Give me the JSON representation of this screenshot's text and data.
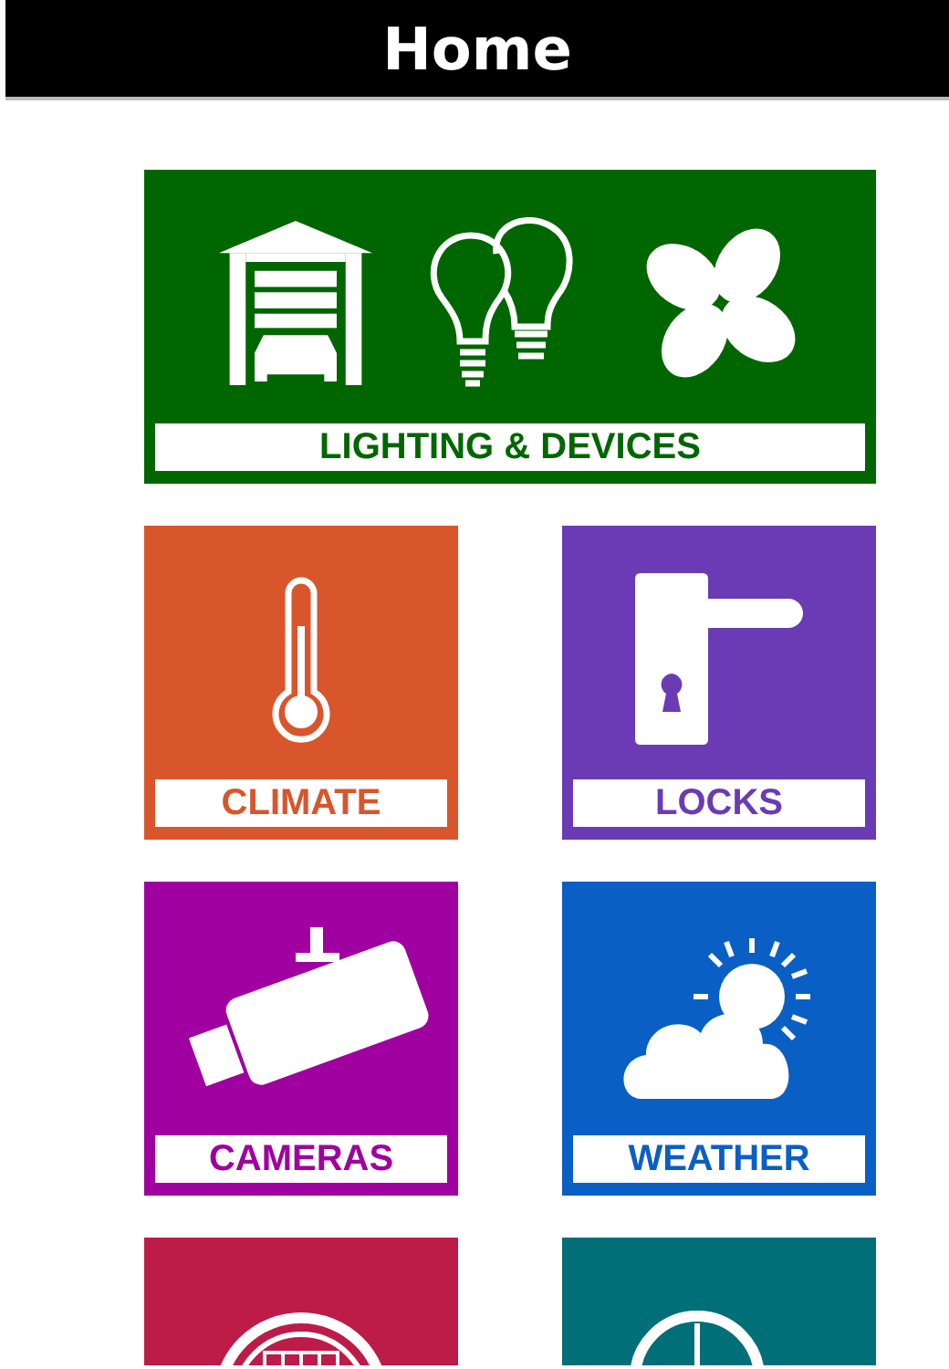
{
  "title": "Home",
  "tiles": [
    {
      "label": "LIGHTING & DEVICES",
      "color": "#006600",
      "wide": true,
      "icons": [
        {
          "kind": "garage"
        },
        {
          "kind": "bulbs"
        },
        {
          "kind": "fan"
        }
      ]
    },
    {
      "label": "CLIMATE",
      "color": "#d9552b",
      "wide": false,
      "icons": [
        {
          "kind": "thermometer"
        }
      ]
    },
    {
      "label": "LOCKS",
      "color": "#6a3bb5",
      "wide": false,
      "icons": [
        {
          "kind": "handle"
        }
      ]
    },
    {
      "label": "CAMERAS",
      "color": "#a000a0",
      "wide": false,
      "icons": [
        {
          "kind": "camera"
        }
      ]
    },
    {
      "label": "WEATHER",
      "color": "#0a5fc4",
      "wide": false,
      "icons": [
        {
          "kind": "weather"
        }
      ]
    },
    {
      "color": "#bd1b48",
      "wide": false,
      "icons": [
        {
          "kind": "meter"
        }
      ]
    },
    {
      "color": "#006f78",
      "wide": false,
      "icons": [
        {
          "kind": "clock"
        }
      ]
    }
  ]
}
